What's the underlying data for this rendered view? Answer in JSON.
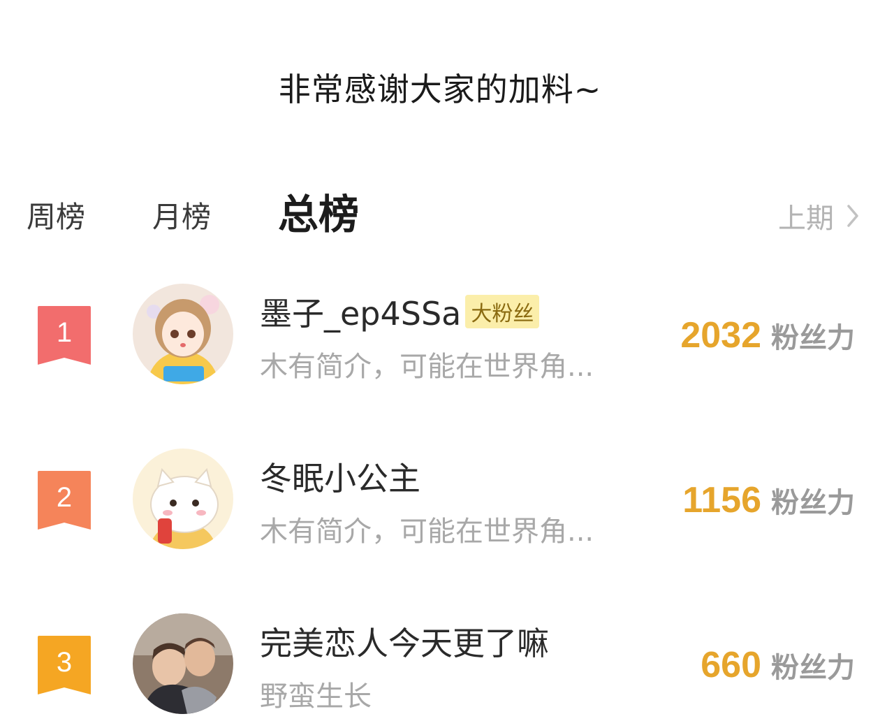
{
  "header": {
    "thanks_text": "非常感谢大家的加料~"
  },
  "tabs": {
    "weekly": "周榜",
    "monthly": "月榜",
    "total": "总榜",
    "active": "total"
  },
  "prev_period": {
    "label": "上期",
    "icon": "chevron-right-icon"
  },
  "leaderboard": [
    {
      "rank": "1",
      "rank_color": "#f26d6d",
      "name": "墨子_ep4SSa",
      "badge": "大粉丝",
      "bio": "木有简介，可能在世界角...",
      "score": "2032",
      "score_unit": "粉丝力",
      "avatar": "anime-girl-avatar"
    },
    {
      "rank": "2",
      "rank_color": "#f5845a",
      "name": "冬眠小公主",
      "badge": "",
      "bio": "木有简介，可能在世界角...",
      "score": "1156",
      "score_unit": "粉丝力",
      "avatar": "cartoon-cat-avatar"
    },
    {
      "rank": "3",
      "rank_color": "#f5a623",
      "name": "完美恋人今天更了嘛",
      "badge": "",
      "bio": "野蛮生长",
      "score": "660",
      "score_unit": "粉丝力",
      "avatar": "couple-photo-avatar"
    }
  ],
  "colors": {
    "score": "#e6a52c",
    "badge_bg": "#fbeeaa",
    "muted": "#a8a8a8"
  }
}
